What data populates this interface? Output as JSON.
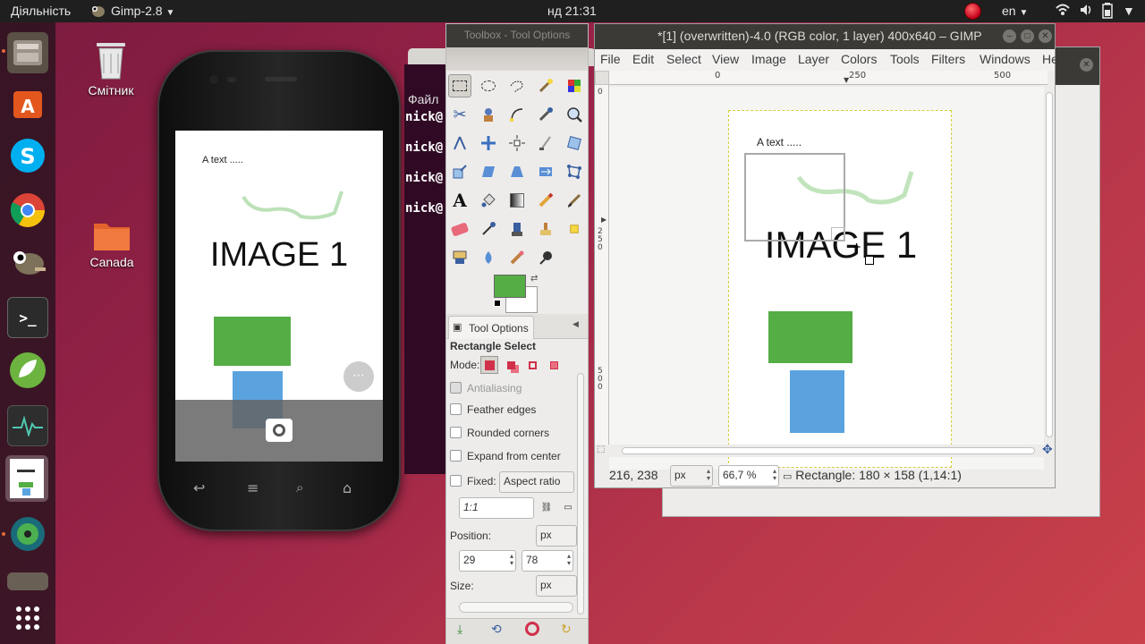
{
  "top_panel": {
    "activities": "Діяльність",
    "app_menu": "Gimp-2.8",
    "clock": "нд 21:31",
    "language": "en"
  },
  "desktop": {
    "trash_label": "Смітник",
    "folder_label": "Canada"
  },
  "phone": {
    "image_caption": "A text .....",
    "image_title": "IMAGE 1",
    "colors": {
      "green": "#55ad45",
      "blue": "#5ba3df"
    }
  },
  "terminal": {
    "menu_label": "Файл",
    "prompt": "nick@"
  },
  "toolbox": {
    "title": "Toolbox - Tool Options",
    "tab_label": "Tool Options",
    "tool_name": "Rectangle Select",
    "mode_label": "Mode:",
    "antialiasing": "Antialiasing",
    "feather_edges": "Feather edges",
    "rounded_corners": "Rounded corners",
    "expand_from_center": "Expand from center",
    "fixed_label": "Fixed:",
    "fixed_option": "Aspect ratio",
    "ratio_value": "1:1",
    "position_label": "Position:",
    "position_unit": "px",
    "position_x": "29",
    "position_y": "78",
    "size_label": "Size:",
    "size_unit": "px",
    "fg_color": "#55ad45",
    "bg_color": "#ffffff"
  },
  "gimp": {
    "title": "*[1] (overwritten)-4.0 (RGB color, 1 layer) 400x640 – GIMP",
    "menus": [
      "File",
      "Edit",
      "Select",
      "View",
      "Image",
      "Layer",
      "Colors",
      "Tools",
      "Filters",
      "Windows",
      "He"
    ],
    "ruler_h": [
      "0",
      "250",
      "500"
    ],
    "ruler_v": [
      "0",
      "2\n5\n0",
      "5\n0\n0"
    ],
    "image_caption": "A text .....",
    "image_title": "IMAGE 1",
    "status": {
      "coords": "216, 238",
      "unit": "px",
      "zoom": "66,7 %",
      "message": "Rectangle: 180 × 158  (1,14:1)"
    }
  }
}
